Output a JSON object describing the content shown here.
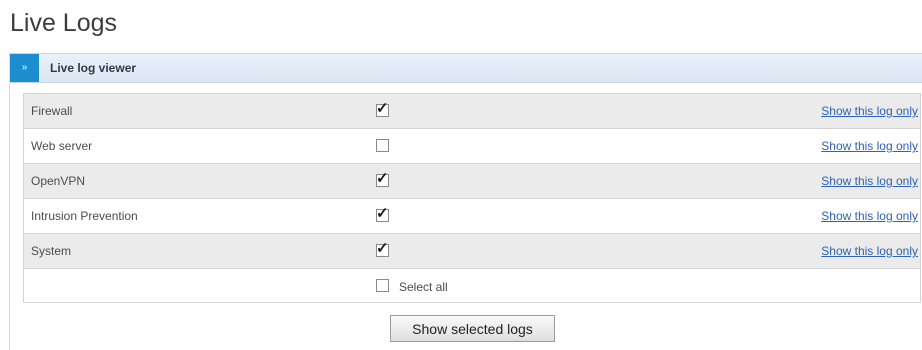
{
  "page": {
    "title": "Live Logs"
  },
  "panel": {
    "toggle_glyph": "»",
    "title": "Live log viewer"
  },
  "logs": [
    {
      "name": "Firewall",
      "checked": true,
      "link": "Show this log only"
    },
    {
      "name": "Web server",
      "checked": false,
      "link": "Show this log only"
    },
    {
      "name": "OpenVPN",
      "checked": true,
      "link": "Show this log only"
    },
    {
      "name": "Intrusion Prevention",
      "checked": true,
      "link": "Show this log only"
    },
    {
      "name": "System",
      "checked": true,
      "link": "Show this log only"
    }
  ],
  "select_all": {
    "label": "Select all",
    "checked": false
  },
  "actions": {
    "show_selected_label": "Show selected logs"
  },
  "colors": {
    "accent": "#1c8ed0",
    "link": "#2d63b8",
    "row_shade": "#ebebeb"
  }
}
